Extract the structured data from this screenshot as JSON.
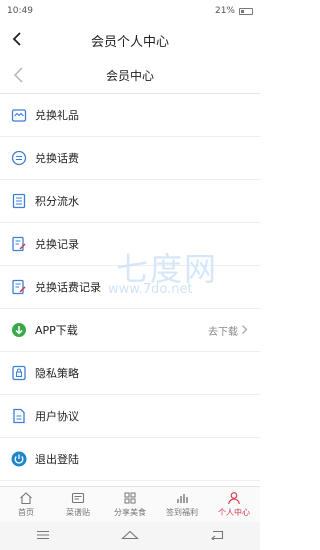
{
  "status": {
    "time": "10:49",
    "battery": "21%"
  },
  "header": {
    "title": "会员个人中心",
    "subtitle": "会员中心"
  },
  "menu": {
    "items": [
      {
        "label": "兑换礼品",
        "icon": "gift-icon"
      },
      {
        "label": "兑换话费",
        "icon": "coin-icon"
      },
      {
        "label": "积分流水",
        "icon": "list-icon"
      },
      {
        "label": "兑换记录",
        "icon": "record-icon"
      },
      {
        "label": "兑换话费记录",
        "icon": "record-icon"
      },
      {
        "label": "APP下载",
        "icon": "download-icon",
        "right": "去下载"
      },
      {
        "label": "隐私策略",
        "icon": "lock-icon"
      },
      {
        "label": "用户协议",
        "icon": "document-icon"
      },
      {
        "label": "退出登陆",
        "icon": "power-icon"
      }
    ]
  },
  "watermark": {
    "big": "七度网",
    "small": "www.7do.net"
  },
  "tabbar": {
    "tabs": [
      {
        "label": "首页",
        "icon": "home-icon"
      },
      {
        "label": "菜谱贴",
        "icon": "recipe-icon"
      },
      {
        "label": "分享美食",
        "icon": "grid-icon"
      },
      {
        "label": "签到福利",
        "icon": "chart-icon"
      },
      {
        "label": "个人中心",
        "icon": "person-icon"
      }
    ],
    "active_color": "#d6334a"
  },
  "colors": {
    "icon_blue": "#3b7fd6",
    "icon_green": "#3aa84a",
    "divider": "#efefef"
  }
}
